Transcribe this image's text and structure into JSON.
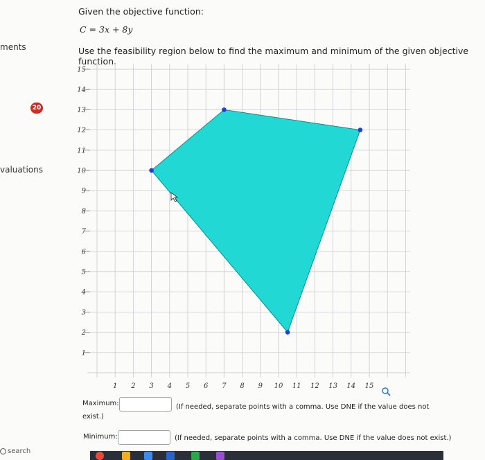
{
  "sidebar": {
    "items": [
      {
        "label": "ments"
      },
      {
        "label": "valuations"
      }
    ],
    "badge": "20",
    "search": "search"
  },
  "question": {
    "heading": "Given the objective function:",
    "formula": "C = 3x + 8y",
    "instructions": "Use the feasibility region below to find the maximum and minimum of the given objective function."
  },
  "chart_data": {
    "type": "scatter",
    "polygon": [
      [
        3,
        10
      ],
      [
        7,
        13
      ],
      [
        14.5,
        12
      ],
      [
        10.5,
        2
      ]
    ],
    "vertices": [
      {
        "x": 3,
        "y": 10
      },
      {
        "x": 7,
        "y": 13
      },
      {
        "x": 14.5,
        "y": 12
      },
      {
        "x": 10.5,
        "y": 2
      }
    ],
    "x_ticks": [
      "1",
      "2",
      "3",
      "4",
      "5",
      "6",
      "7",
      "8",
      "9",
      "10",
      "11",
      "12",
      "13",
      "14",
      "15"
    ],
    "y_ticks": [
      "1",
      "2",
      "3",
      "4",
      "5",
      "6",
      "7",
      "8",
      "9",
      "10",
      "11",
      "12",
      "13",
      "14",
      "15"
    ],
    "xlim": [
      0,
      16
    ],
    "ylim": [
      0,
      16
    ],
    "grid": true,
    "colors": {
      "fill": "#22d8d4",
      "edge": "#0a8f8c",
      "vertex": "#1f3fd4"
    }
  },
  "answers": {
    "maximum_label": "Maximum:",
    "maximum_label_cont": "exist.)",
    "maximum_hint": "(If needed, separate points with a comma. Use DNE if the value does not",
    "maximum_value": "",
    "minimum_label": "Minimum:",
    "minimum_hint": "(If needed, separate points with a comma. Use DNE if the value does not exist.)",
    "minimum_value": ""
  },
  "icons": {
    "zoom": "magnifier-icon",
    "cursor": "pointer-icon"
  }
}
